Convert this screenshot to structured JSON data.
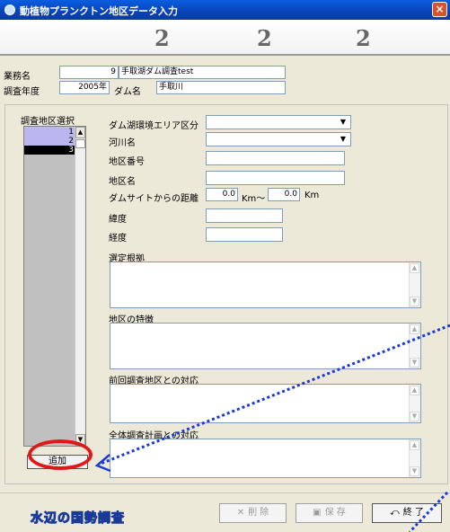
{
  "window": {
    "title": "動植物プランクトン地区データ入力",
    "close_label": "×"
  },
  "rings": [
    "2",
    "2",
    "2"
  ],
  "header": {
    "business_label": "業務名",
    "business_no": "9",
    "business_name": "手取湖ダム調査test",
    "year_label": "調査年度",
    "year_value": "2005年",
    "dam_label": "ダム名",
    "dam_value": "手取川"
  },
  "district_list": {
    "caption": "調査地区選択",
    "items": [
      "1",
      "2",
      "3"
    ],
    "add_button": "追加"
  },
  "form": {
    "area_label": "ダム湖環境エリア区分",
    "river_label": "河川名",
    "district_no_label": "地区番号",
    "district_name_label": "地区名",
    "distance_label": "ダムサイトからの距離",
    "distance_from": "0.0",
    "distance_to": "0.0",
    "unit_km_from": "Km〜",
    "unit_km_to": "Km",
    "latitude_label": "緯度",
    "longitude_label": "経度",
    "reason_label": "選定根拠",
    "feature_label": "地区の特徴",
    "previous_label": "前回調査地区との対応",
    "plan_label": "全体調査計画との対応"
  },
  "footer": {
    "logo_text": "水辺の国勢調査",
    "delete_label": "削 除",
    "save_label": "保 存",
    "exit_label": "終 了"
  },
  "colors": {
    "title_bar": "#0842b8",
    "selected_row": "#b9b6f0",
    "annotation_red": "#e01818",
    "annotation_blue": "#1a3ad8"
  }
}
